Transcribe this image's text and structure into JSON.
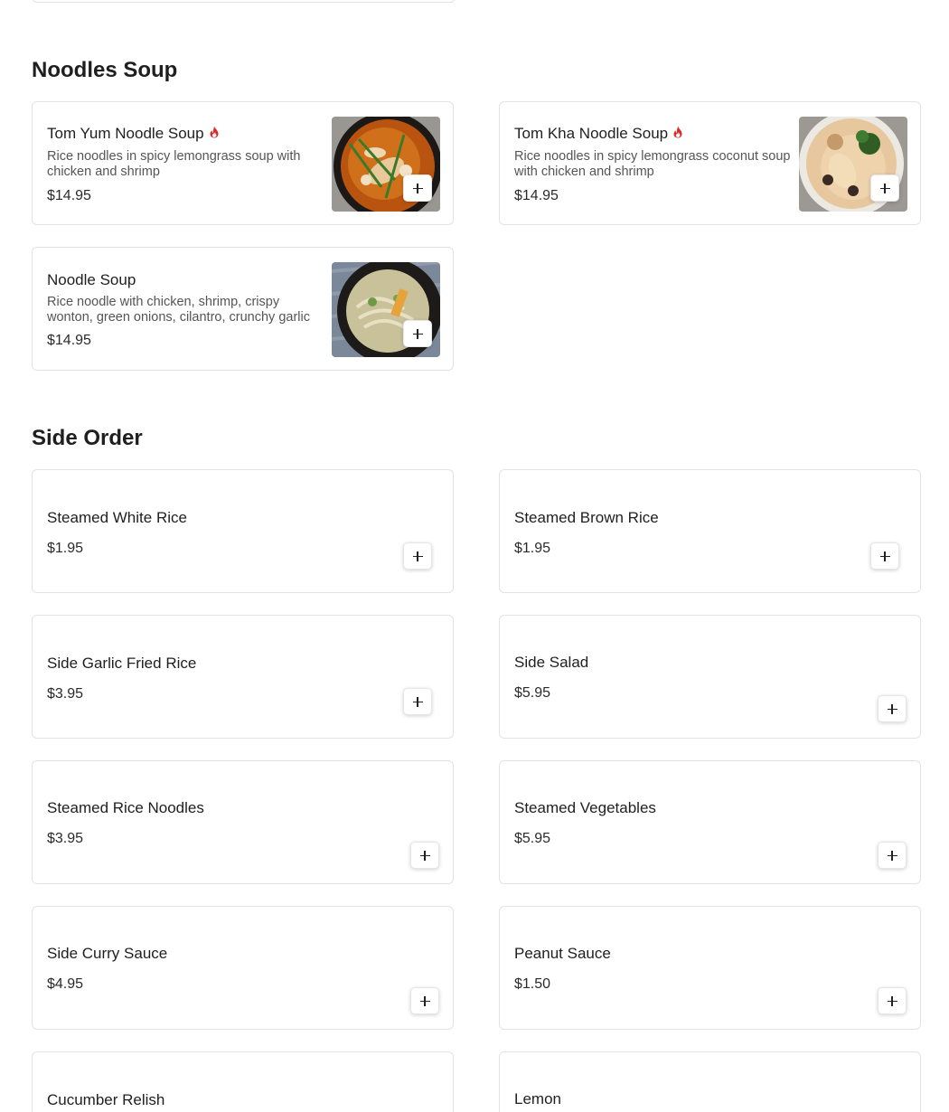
{
  "sections": [
    {
      "title": "Noodles Soup",
      "items": [
        {
          "name": "Tom Yum Noodle Soup",
          "spicy": true,
          "description": "Rice noodles in spicy lemongrass soup with chicken and shrimp",
          "price": "$14.95",
          "image": "tom-yum-noodle-soup-photo"
        },
        {
          "name": "Tom Kha Noodle Soup",
          "spicy": true,
          "description": "Rice noodles in spicy lemongrass coconut soup with chicken and shrimp",
          "price": "$14.95",
          "image": "tom-kha-noodle-soup-photo"
        },
        {
          "name": "Noodle Soup",
          "spicy": false,
          "description": "Rice noodle with chicken, shrimp, crispy wonton, green onions, cilantro, crunchy garlic",
          "price": "$14.95",
          "image": "noodle-soup-photo"
        }
      ]
    },
    {
      "title": "Side Order",
      "items": [
        {
          "name": "Steamed White Rice",
          "price": "$1.95"
        },
        {
          "name": "Steamed Brown Rice",
          "price": "$1.95"
        },
        {
          "name": "Side Garlic Fried Rice",
          "price": "$3.95"
        },
        {
          "name": "Side Salad",
          "price": "$5.95"
        },
        {
          "name": "Steamed Rice Noodles",
          "price": "$3.95"
        },
        {
          "name": "Steamed Vegetables",
          "price": "$5.95"
        },
        {
          "name": "Side Curry Sauce",
          "price": "$4.95"
        },
        {
          "name": "Peanut Sauce",
          "price": "$1.50"
        },
        {
          "name": "Cucumber Relish",
          "price": ""
        },
        {
          "name": "Lemon",
          "price": ""
        }
      ]
    }
  ],
  "icons": {
    "spicy": "flame-icon",
    "add": "plus-icon"
  },
  "colors": {
    "spicy_flame": "#d92b2b",
    "card_border": "#e3e3e3",
    "description_text": "#555555"
  }
}
